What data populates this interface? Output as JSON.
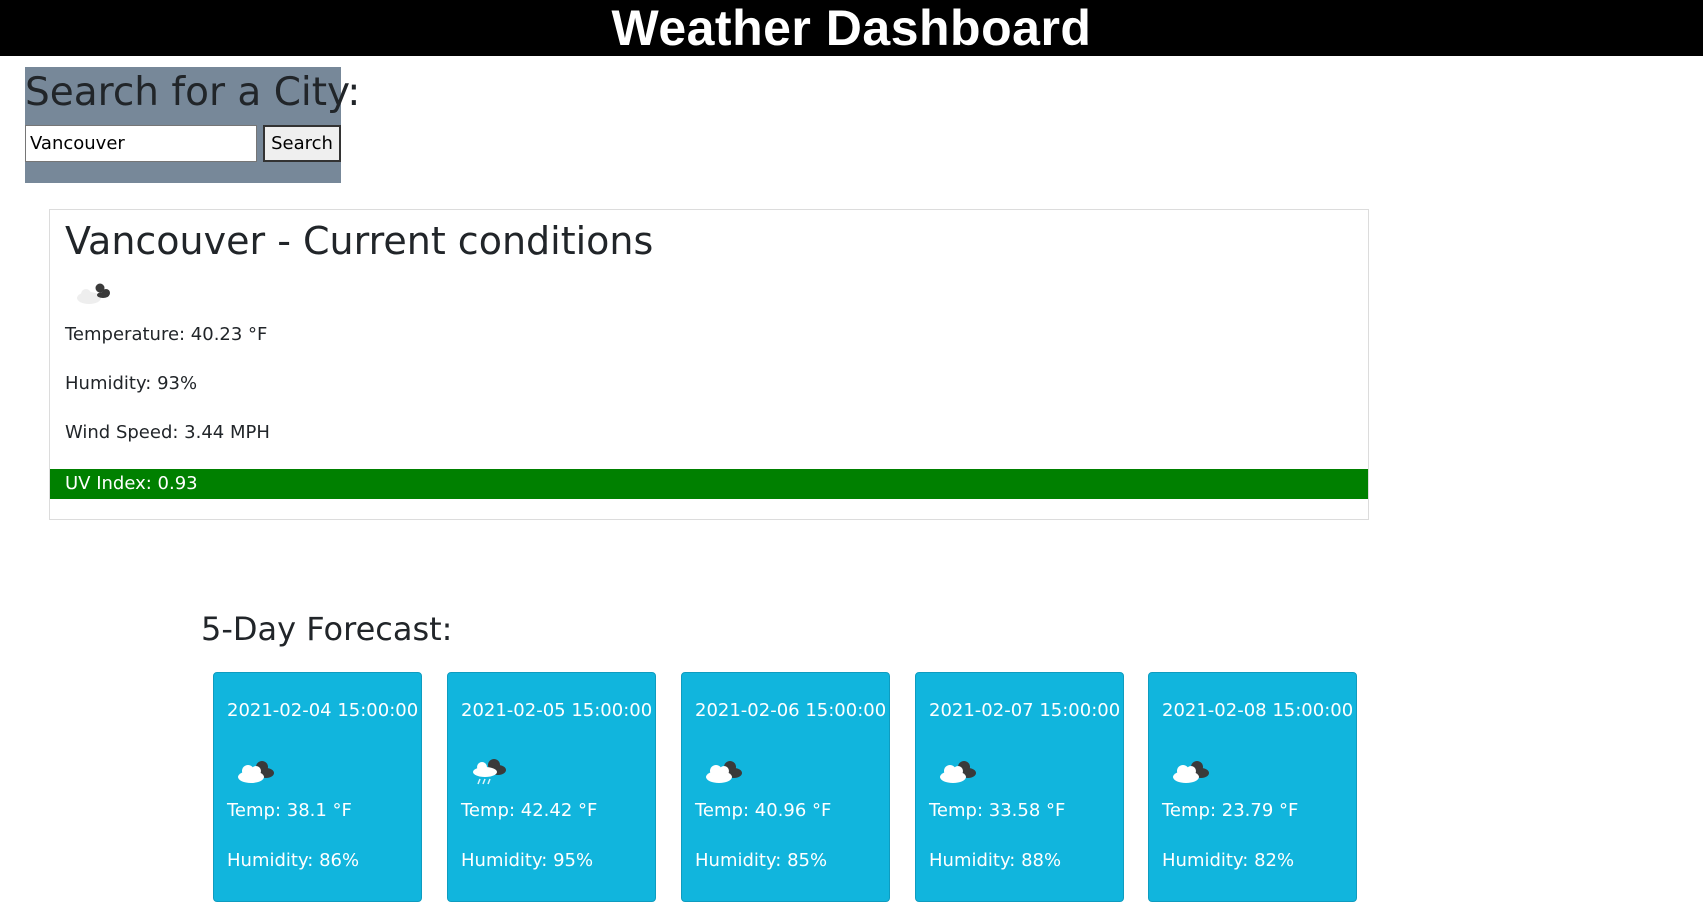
{
  "header": {
    "title": "Weather Dashboard"
  },
  "search": {
    "heading": "Search for a City:",
    "input_value": "Vancouver",
    "button_label": "Search",
    "panel_color": "#778899"
  },
  "current": {
    "title": "Vancouver - Current conditions",
    "icon": "broken-clouds-icon",
    "temperature": "Temperature: 40.23 °F",
    "humidity": "Humidity: 93%",
    "wind_speed": "Wind Speed: 3.44 MPH",
    "uv_index": "UV Index: 0.93",
    "uv_color": "#008000"
  },
  "forecast": {
    "heading": "5-Day Forecast:",
    "card_color": "#11b5dd",
    "days": [
      {
        "date": "2021-02-04 15:00:00",
        "icon": "broken-clouds-icon",
        "temp": "Temp: 38.1 °F",
        "humidity": "Humidity: 86%"
      },
      {
        "date": "2021-02-05 15:00:00",
        "icon": "rain-cloud-icon",
        "temp": "Temp: 42.42 °F",
        "humidity": "Humidity: 95%"
      },
      {
        "date": "2021-02-06 15:00:00",
        "icon": "broken-clouds-icon",
        "temp": "Temp: 40.96 °F",
        "humidity": "Humidity: 85%"
      },
      {
        "date": "2021-02-07 15:00:00",
        "icon": "broken-clouds-icon",
        "temp": "Temp: 33.58 °F",
        "humidity": "Humidity: 88%"
      },
      {
        "date": "2021-02-08 15:00:00",
        "icon": "broken-clouds-icon",
        "temp": "Temp: 23.79 °F",
        "humidity": "Humidity: 82%"
      }
    ]
  }
}
